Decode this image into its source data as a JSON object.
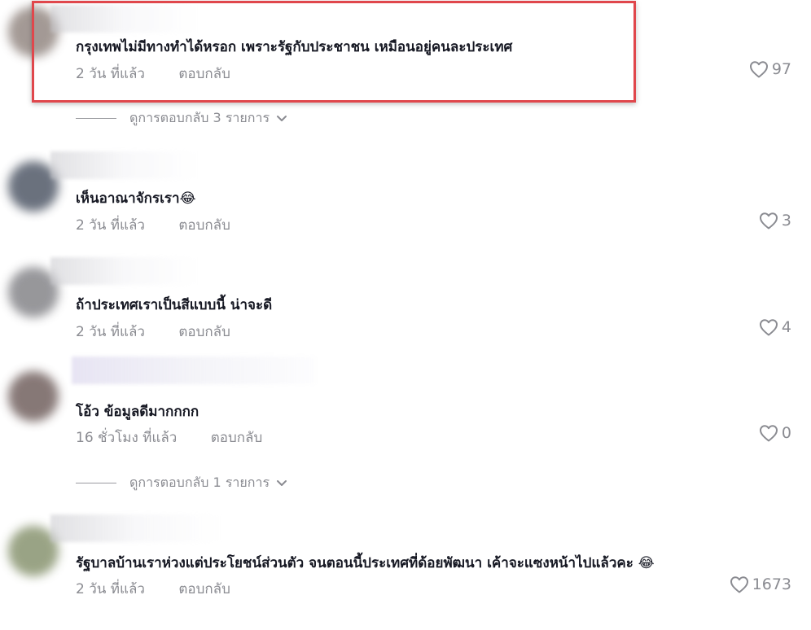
{
  "comments": [
    {
      "text": "กรุงเทพไม่มีทางทำได้หรอก เพราะรัฐกับประชาชน เหมือนอยู่คนละประเทศ",
      "time": "2 วัน ที่แล้ว",
      "reply": "ตอบกลับ",
      "likes": "97",
      "avatar_color": "#9a8f8a"
    },
    {
      "text": "เห็นอาณาจักรเรา😂",
      "time": "2 วัน ที่แล้ว",
      "reply": "ตอบกลับ",
      "likes": "3",
      "avatar_color": "#5a6270"
    },
    {
      "text": "ถ้าประเทศเราเป็นสีแบบนี้ น่าจะดี",
      "time": "2 วัน ที่แล้ว",
      "reply": "ตอบกลับ",
      "likes": "4",
      "avatar_color": "#8c8c90"
    },
    {
      "text": "โอ้ว ข้อมูลดีมากกกก",
      "time": "16 ชั่วโมง ที่แล้ว",
      "reply": "ตอบกลับ",
      "likes": "0",
      "avatar_color": "#7a6a68"
    },
    {
      "text": "รัฐบาลบ้านเราห่วงแต่ประโยชน์ส่วนตัว จนตอนนี้ประเทศที่ด้อยพัฒนา เค้าจะแซงหน้าไปแล้วคะ 😂",
      "time": "2 วัน ที่แล้ว",
      "reply": "ตอบกลับ",
      "likes": "1673",
      "avatar_color": "#8f9a78"
    }
  ],
  "view_replies": [
    {
      "label": "ดูการตอบกลับ 3 รายการ"
    },
    {
      "label": "ดูการตอบกลับ 1 รายการ"
    }
  ],
  "colors": {
    "highlight": "#e0474c",
    "muted": "#8a8b91",
    "text": "#161823"
  },
  "icons": {
    "like": "heart-outline-icon",
    "expand": "chevron-down-icon"
  }
}
